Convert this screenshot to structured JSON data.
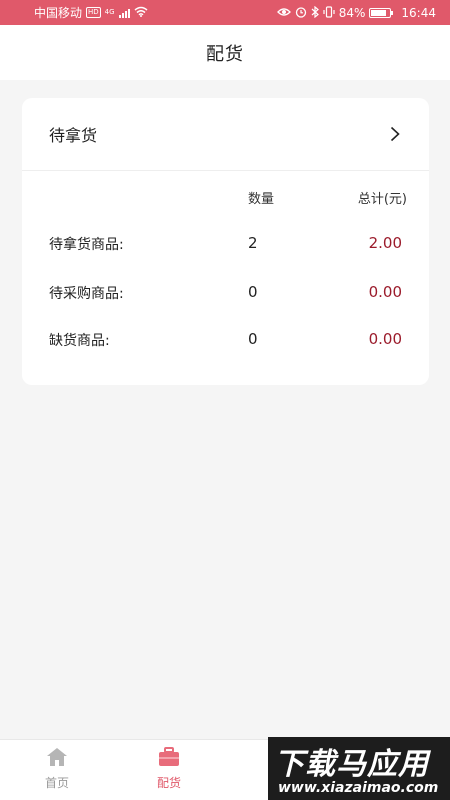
{
  "status_bar": {
    "carrier": "中国移动",
    "hd": "HD",
    "network": "4G",
    "battery_percent": "84%",
    "battery_level": 0.84,
    "time": "16:44",
    "icons": [
      "wifi-icon",
      "eye-icon",
      "alarm-icon",
      "bluetooth-icon",
      "vibrate-icon",
      "battery-icon"
    ]
  },
  "header": {
    "title": "配货"
  },
  "card": {
    "title": "待拿货",
    "columns": {
      "qty": "数量",
      "total": "总计(元)"
    },
    "rows": [
      {
        "label": "待拿货商品:",
        "qty": "2",
        "total": "2.00"
      },
      {
        "label": "待采购商品:",
        "qty": "0",
        "total": "0.00"
      },
      {
        "label": "缺货商品:",
        "qty": "0",
        "total": "0.00"
      }
    ]
  },
  "tabs": [
    {
      "label": "首页",
      "icon": "home-icon",
      "active": false
    },
    {
      "label": "配货",
      "icon": "briefcase-icon",
      "active": true
    }
  ],
  "watermark": {
    "main": "下载马应用",
    "sub": "www.xiazaimao.com"
  },
  "colors": {
    "accent": "#e0596a",
    "amount": "#9b1b2b",
    "background": "#f5f5f5"
  }
}
